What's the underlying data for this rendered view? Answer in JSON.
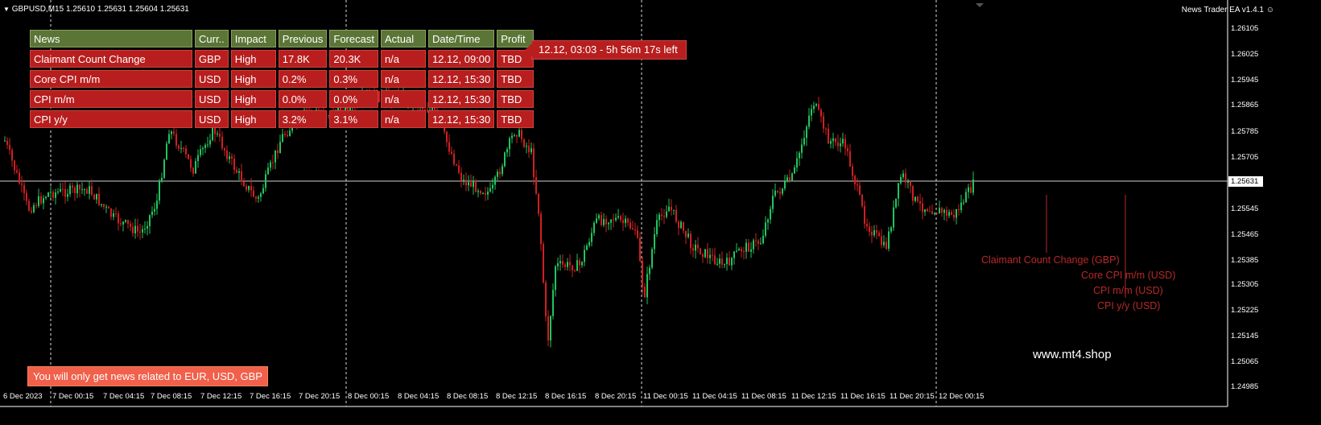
{
  "header": {
    "symbol_line": "GBPUSD,M15  1.25610 1.25631 1.25604 1.25631",
    "ea_name": "News Trader EA  v1.4.1"
  },
  "news_table": {
    "headers": [
      "News",
      "Curr..",
      "Impact",
      "Previous",
      "Forecast",
      "Actual",
      "Date/Time",
      "Profit"
    ],
    "rows": [
      [
        "Claimant Count Change",
        "GBP",
        "High",
        "17.8K",
        "20.3K",
        "n/a",
        "12.12, 09:00",
        "TBD"
      ],
      [
        "Core CPI m/m",
        "USD",
        "High",
        "0.2%",
        "0.3%",
        "n/a",
        "12.12, 15:30",
        "TBD"
      ],
      [
        "CPI m/m",
        "USD",
        "High",
        "0.0%",
        "0.0%",
        "n/a",
        "12.12, 15:30",
        "TBD"
      ],
      [
        "CPI y/y",
        "USD",
        "High",
        "3.2%",
        "3.1%",
        "n/a",
        "12.12, 15:30",
        "TBD"
      ]
    ]
  },
  "countdown": "12.12, 03:03 - 5h 56m 17s left",
  "notice": "You will only get news related to EUR, USD, GBP",
  "watermark": "www.mt4.shop",
  "event_labels": [
    "Claimant Count Change (GBP)",
    "Core CPI m/m (USD)",
    "CPI m/m (USD)",
    "CPI y/y (USD)"
  ],
  "price_axis": [
    "1.26105",
    "1.26025",
    "1.25945",
    "1.25865",
    "1.25785",
    "1.25705",
    "1.25545",
    "1.25465",
    "1.25385",
    "1.25305",
    "1.25225",
    "1.25145",
    "1.25065",
    "1.24985"
  ],
  "current_price": "1.25631",
  "time_axis": [
    "6 Dec 2023",
    "7 Dec 00:15",
    "7 Dec 04:15",
    "7 Dec 08:15",
    "7 Dec 12:15",
    "7 Dec 16:15",
    "7 Dec 20:15",
    "8 Dec 00:15",
    "8 Dec 04:15",
    "8 Dec 08:15",
    "8 Dec 12:15",
    "8 Dec 16:15",
    "8 Dec 20:15",
    "11 Dec 00:15",
    "11 Dec 04:15",
    "11 Dec 08:15",
    "11 Dec 12:15",
    "11 Dec 16:15",
    "11 Dec 20:15",
    "12 Dec 00:15"
  ],
  "colors": {
    "bull": "#22c55e",
    "bear": "#d02020",
    "header_green": "#5a7535",
    "row_red": "#b81e1e",
    "notice": "#f0604a"
  }
}
